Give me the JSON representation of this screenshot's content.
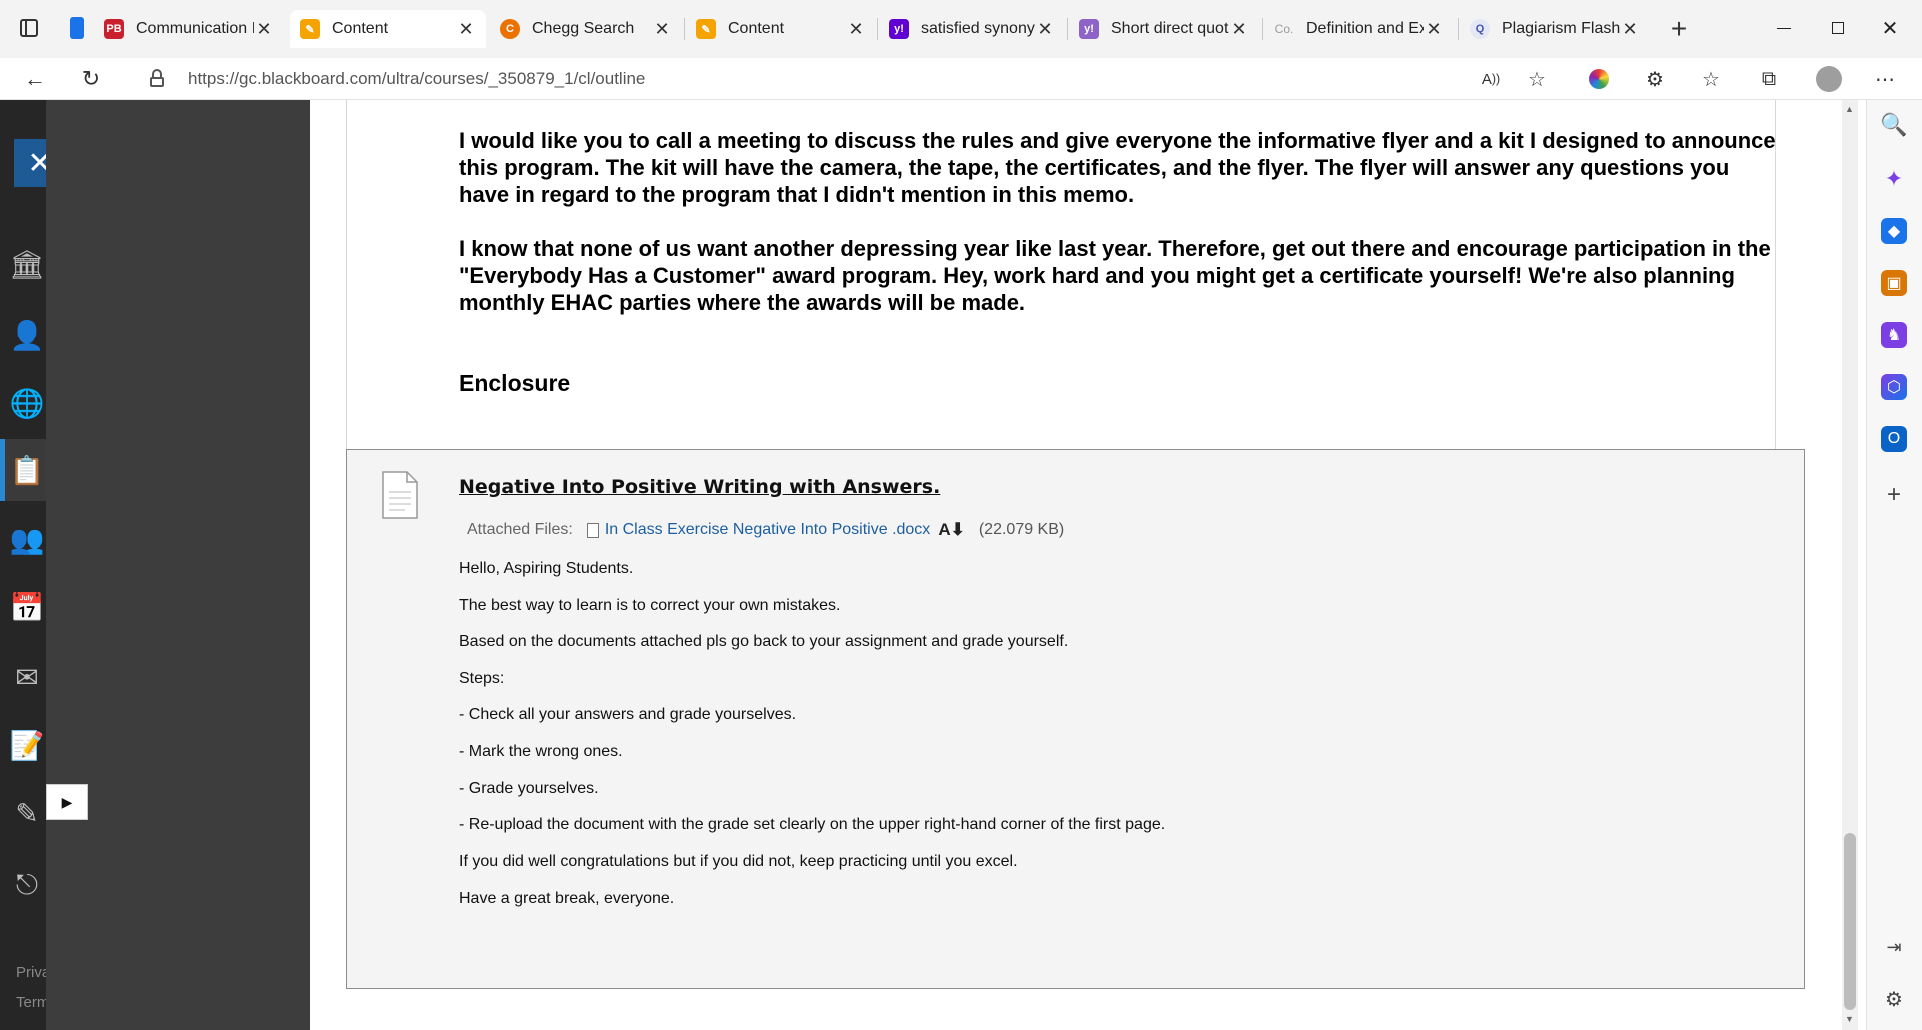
{
  "browser": {
    "tabs": [
      {
        "title": "",
        "favicon": "sidebar-icon",
        "color": "#ffffff"
      },
      {
        "title": "",
        "favicon": "bookmark-icon",
        "color": "#1a73e8"
      },
      {
        "title": "Communication I",
        "favicon": "pb-icon",
        "color": "#c8202f",
        "letter": "PB"
      },
      {
        "title": "Content",
        "favicon": "blackboard-icon",
        "color": "#f5a300",
        "active": true
      },
      {
        "title": "Chegg Search",
        "favicon": "chegg-icon",
        "color": "#eb7100",
        "letter": "C"
      },
      {
        "title": "Content",
        "favicon": "blackboard-icon",
        "color": "#f5a300"
      },
      {
        "title": "satisfied synonym",
        "favicon": "yahoo-icon",
        "color": "#6001d2",
        "letter": "y!"
      },
      {
        "title": "Short direct quot",
        "favicon": "yahoo-icon",
        "color": "#8e63c7",
        "letter": "y!"
      },
      {
        "title": "Definition and Ex",
        "favicon": "co-icon",
        "color": "#9a9a9a",
        "letter": "Co."
      },
      {
        "title": "Plagiarism Flashc",
        "favicon": "quizlet-icon",
        "color": "#4257b2",
        "letter": "Q"
      }
    ],
    "url": "https://gc.blackboard.com/ultra/courses/_350879_1/cl/outline"
  },
  "memo": {
    "paragraph1": "I would like you to call a meeting to discuss the rules and give everyone the informative flyer and a kit I designed to announce this program. The kit will have the camera, the tape, the certificates, and the flyer. The flyer will answer any questions you have in regard to the program that I didn't mention in this memo.",
    "paragraph2": "I know that none of us want another depressing year like last year. Therefore, get out there and encourage participation in the \"Everybody Has a Customer\" award program. Hey, work hard and you might get a certificate yourself! We're also planning monthly EHAC parties where the awards will be made.",
    "enclosure": "Enclosure"
  },
  "item": {
    "title": "Negative Into Positive Writing with Answers.",
    "attached_label": "Attached Files:",
    "file_name": "In Class Exercise Negative Into Positive .docx",
    "file_size": "(22.079 KB)",
    "body": [
      "Hello, Aspiring Students.",
      "The best way to learn is to correct your own mistakes.",
      "Based on the documents attached pls go back to your assignment and grade yourself.",
      "Steps:",
      "- Check all your answers and grade yourselves.",
      "- Mark the wrong ones.",
      "- Grade yourselves.",
      "- Re-upload the document with the grade set clearly on the upper right-hand corner of the first page.",
      "If you did well congratulations but if you did not, keep practicing until you excel.",
      "Have a great break, everyone."
    ]
  },
  "nav": {
    "footer1": "Priva",
    "footer2": "Term"
  }
}
